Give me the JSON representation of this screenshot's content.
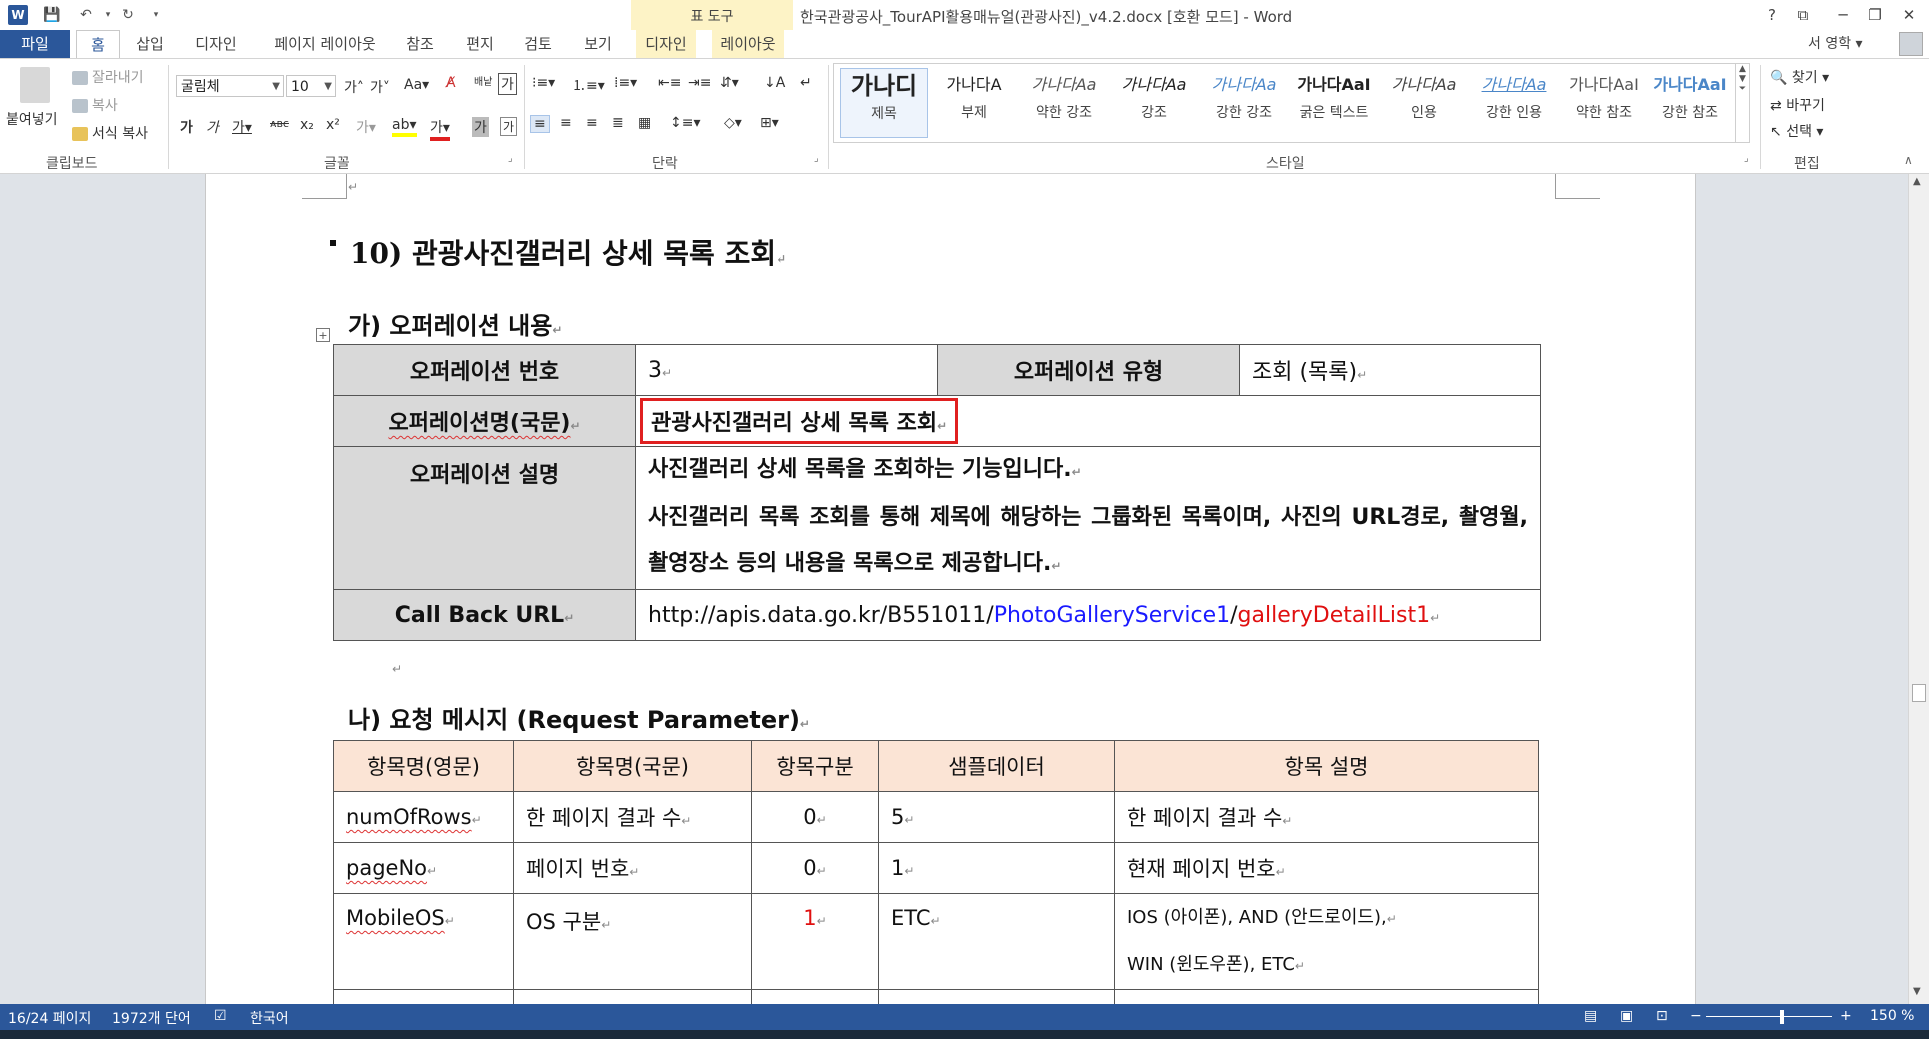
{
  "window": {
    "title": "한국관광공사_TourAPI활용매뉴얼(관광사진)_v4.2.docx [호환 모드] - Word",
    "context_group": "표 도구",
    "controls": [
      "?",
      "⧉",
      "─",
      "❐",
      "✕"
    ]
  },
  "tabs": {
    "file": "파일",
    "items": [
      "홈",
      "삽입",
      "디자인",
      "페이지 레이아웃",
      "참조",
      "편지",
      "검토",
      "보기"
    ],
    "context_items": [
      "디자인",
      "레이아웃"
    ],
    "active": "홈"
  },
  "user": {
    "name": "서 영학 ▾"
  },
  "ribbon": {
    "clipboard": {
      "paste": "붙여넣기",
      "cut": "잘라내기",
      "copy": "복사",
      "format_painter": "서식 복사",
      "label": "클립보드"
    },
    "font": {
      "font_name": "굴림체",
      "font_size": "10",
      "label": "글꼴"
    },
    "paragraph": {
      "label": "단락"
    },
    "styles": {
      "label": "스타일",
      "items": [
        {
          "preview": "가나디",
          "name": "제목"
        },
        {
          "preview": "가나다A",
          "name": "부제"
        },
        {
          "preview": "가나다Aa",
          "name": "약한 강조"
        },
        {
          "preview": "가나다Aa",
          "name": "강조"
        },
        {
          "preview": "가나다Aa",
          "name": "강한 강조"
        },
        {
          "preview": "가나다AaI",
          "name": "굵은 텍스트"
        },
        {
          "preview": "가나다Aa",
          "name": "인용"
        },
        {
          "preview": "가나다Aa",
          "name": "강한 인용"
        },
        {
          "preview": "가나다AaI",
          "name": "약한 참조"
        },
        {
          "preview": "가나다AaI",
          "name": "강한 참조"
        }
      ]
    },
    "editing": {
      "find": "찾기 ▾",
      "replace": "바꾸기",
      "select": "선택 ▾",
      "label": "편집"
    }
  },
  "document": {
    "section_heading": "10) 관광사진갤러리 상세 목록 조회",
    "sub_a": "가) 오퍼레이션 내용",
    "op_table": {
      "op_no_label": "오퍼레이션 번호",
      "op_no": "3",
      "op_type_label": "오퍼레이션 유형",
      "op_type": "조회 (목록)",
      "op_name_label": "오퍼레이션명(국문)",
      "op_name": "관광사진갤러리 상세 목록 조회",
      "op_desc_label": "오퍼레이션 설명",
      "op_desc_1": "사진갤러리 상세 목록을 조회하는 기능입니다.",
      "op_desc_2": "사진갤러리 목록 조회를 통해 제목에 해당하는 그룹화된 목록이며, 사진의 URL경로, 촬영월, 촬영장소 등의 내용을 목록으로 제공합니다.",
      "callback_label": "Call Back URL",
      "callback_base": "http://apis.data.go.kr/B551011/",
      "callback_service": "PhotoGalleryService1",
      "callback_slash": "/",
      "callback_op": "galleryDetailList1"
    },
    "sub_b": "나) 요청 메시지 (Request Parameter)",
    "req_table": {
      "headers": [
        "항목명(영문)",
        "항목명(국문)",
        "항목구분",
        "샘플데이터",
        "항목 설명"
      ],
      "rows": [
        {
          "en": "numOfRows",
          "ko": "한 페이지 결과 수",
          "type": "0",
          "sample": "5",
          "desc": "한 페이지 결과 수"
        },
        {
          "en": "pageNo",
          "ko": "페이지 번호",
          "type": "0",
          "sample": "1",
          "desc": "현재 페이지 번호"
        },
        {
          "en": "MobileOS",
          "ko": "OS 구분",
          "type": "1",
          "sample": "ETC",
          "desc": "IOS (아이폰), AND (안드로이드),",
          "desc2": "WIN (윈도우폰), ETC"
        }
      ]
    }
  },
  "status": {
    "page": "16/24 페이지",
    "words": "1972개 단어",
    "language": "한국어",
    "zoom": "150 %"
  },
  "colors": {
    "accent": "#2b579a",
    "context_tab_bg": "#fdf3c6",
    "table_header_gray": "#d9d9d9",
    "table_header_peach": "#fbe4d5",
    "highlight_box": "#e02020",
    "link_blue": "#1a1aff",
    "link_red": "#e01010"
  }
}
